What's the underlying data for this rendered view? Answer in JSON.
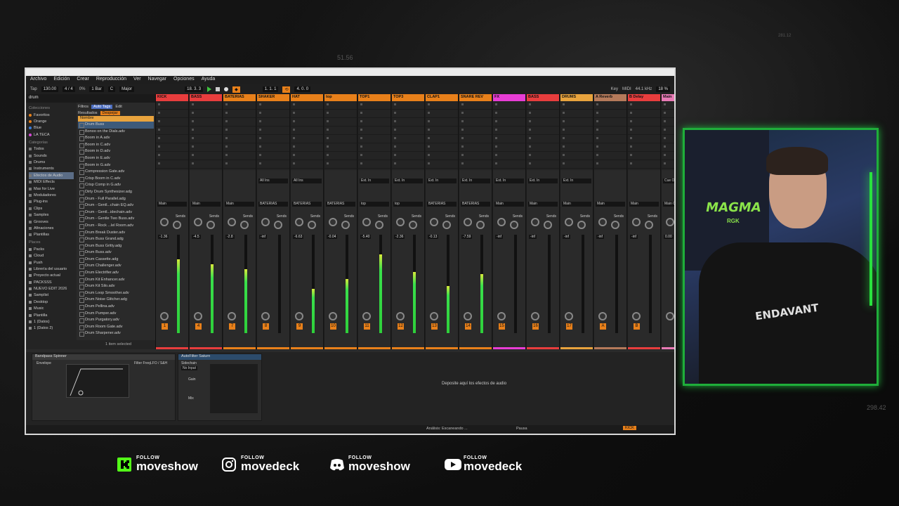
{
  "background": {
    "numbers": [
      "51.56",
      "281.12",
      "298.42"
    ]
  },
  "menu": [
    "Archivo",
    "Edición",
    "Crear",
    "Reproducción",
    "Ver",
    "Navegar",
    "Opciones",
    "Ayuda"
  ],
  "transport": {
    "tap": "Tap",
    "bpm": "130.00",
    "signature": "4 / 4",
    "pct": "0%",
    "bar": "1 Bar",
    "key": "C",
    "scale": "Major",
    "position": "18. 3. 3",
    "loop_start": "1. 1. 1",
    "loop_len": "4. 0. 0",
    "key_label": "Key",
    "midi_label": "MIDI",
    "sample_rate": "44.1 kHz",
    "cpu": "18 %"
  },
  "browser": {
    "search": "drum",
    "filters": "Filtros",
    "auto_tags": "Auto Tags",
    "edit": "Edit",
    "results_label": "Resultados",
    "clear_label": "Despejar",
    "name_header": "Nombre",
    "colecciones_head": "Colecciones",
    "colecciones": [
      {
        "label": "Favoritos",
        "color": "#e8801a"
      },
      {
        "label": "Orange",
        "color": "#e8801a"
      },
      {
        "label": "Blue",
        "color": "#3a7bd5"
      },
      {
        "label": "LA TECA",
        "color": "#d54ad5"
      }
    ],
    "categorias_head": "Categorías",
    "categorias": [
      "Todos",
      "Sounds",
      "Drums",
      "Instruments",
      "Efectos de Audio",
      "MIDI Effects",
      "Max for Live",
      "Moduladores",
      "Plug-ins",
      "Clips",
      "Samples",
      "Grooves",
      "Afinaciones",
      "Plantillas"
    ],
    "lugares_head": "Places",
    "lugares": [
      "Packs",
      "Cloud",
      "Push",
      "Librería del usuario",
      "Proyecto actual",
      "PACKSSS",
      "NUEVO EDIT 2026",
      "Samplist",
      "Desktop",
      "Music",
      "Plantilla",
      "1 (Datos)",
      "1 (Datos 2)"
    ],
    "items": [
      "Drum Buss",
      "Bonoo on the Dials.adv",
      "Boom in A.adv",
      "Boom in C.adv",
      "Boom in D.adv",
      "Boom in E.adv",
      "Boom in G.adv",
      "Compression Gate.adv",
      "Crisp Boom in C.adv",
      "Crisp Comp in G.adv",
      "Dirty Drum Synthesizer.adg",
      "Drum - Full Parallel.adg",
      "Drum - Gentl...chain EQ.adv",
      "Drum - Gentl...idechain.adv",
      "Drum - Gentle Two Buss.adv",
      "Drum - Rock ...lel Room.adv",
      "Drum Break Duster.adv",
      "Drum Buss Grand.adg",
      "Drum Buss Gritty.adg",
      "Drum Buss.adv",
      "Drum Cassette.adg",
      "Drum Challenger.adv",
      "Drum Electrifier.adv",
      "Drum Kit Enhancer.adv",
      "Drum Kit Silo.adv",
      "Drum Loop Smoother.adv",
      "Drum Noise Glitcher.adg",
      "Drum Pellina.adv",
      "Drum Pumper.adv",
      "Drum Purgatory.adv",
      "Drum Room Gate.adv",
      "Drum Sharpener.adv"
    ],
    "footer": "1 item selected"
  },
  "mixer": {
    "sends_label": "Sends",
    "tracks": [
      {
        "name": "KICK",
        "color": "#e83d3d",
        "vol": "-1.36",
        "num": "1",
        "meter": 0.75,
        "input": "",
        "route": "Main"
      },
      {
        "name": "BASS",
        "color": "#e83d3d",
        "vol": "-4.5",
        "num": "4",
        "meter": 0.7,
        "input": "",
        "route": "Main"
      },
      {
        "name": "BATERIAS",
        "color": "#e8801a",
        "vol": "-2.8",
        "num": "7",
        "meter": 0.65,
        "input": "",
        "route": "Main"
      },
      {
        "name": "SHAKER",
        "color": "#e8801a",
        "vol": "-inf",
        "num": "8",
        "meter": 0.0,
        "input": "All Ins",
        "route": "BATERIAS"
      },
      {
        "name": "HAT",
        "color": "#e8801a",
        "vol": "-6.63",
        "num": "9",
        "meter": 0.45,
        "input": "All Ins",
        "route": "BATERIAS"
      },
      {
        "name": "top",
        "color": "#e8801a",
        "vol": "-0.04",
        "num": "10",
        "meter": 0.55,
        "input": "",
        "route": "BATERIAS"
      },
      {
        "name": "TOP1",
        "color": "#e8801a",
        "vol": "-5.40",
        "num": "11",
        "meter": 0.8,
        "input": "Ext. In",
        "route": "top"
      },
      {
        "name": "TOP3",
        "color": "#e8801a",
        "vol": "-2.36",
        "num": "12",
        "meter": 0.62,
        "input": "Ext. In",
        "route": "top"
      },
      {
        "name": "CLAP1",
        "color": "#e8801a",
        "vol": "-0.13",
        "num": "13",
        "meter": 0.48,
        "input": "Ext. In",
        "route": "BATERIAS"
      },
      {
        "name": "SNARE REV",
        "color": "#e8801a",
        "vol": "-7.59",
        "num": "14",
        "meter": 0.6,
        "input": "Ext. In",
        "route": "BATERIAS"
      },
      {
        "name": "FX",
        "color": "#e83dd5",
        "vol": "-inf",
        "num": "15",
        "meter": 0.0,
        "input": "Ext. In",
        "route": "Main"
      },
      {
        "name": "BASS",
        "color": "#e83d3d",
        "vol": "-inf",
        "num": "16",
        "meter": 0.0,
        "input": "Ext. In",
        "route": "Main"
      },
      {
        "name": "DRUMS",
        "color": "#e8a33d",
        "vol": "-inf",
        "num": "17",
        "meter": 0.0,
        "input": "Ext. In",
        "route": "Main"
      },
      {
        "name": "A Reverb",
        "color": "#b57a5a",
        "vol": "-inf",
        "num": "A",
        "meter": 0.0,
        "input": "",
        "route": "Main"
      },
      {
        "name": "B Delay",
        "color": "#e83d3d",
        "vol": "-inf",
        "num": "B",
        "meter": 0.0,
        "input": "",
        "route": "Main"
      },
      {
        "name": "Main",
        "color": "#e87ab5",
        "vol": "0.00",
        "num": "",
        "meter": 0.55,
        "input": "Cue Out",
        "route": "Main Out"
      }
    ]
  },
  "devices": {
    "dev1_title": "Bandpass Spinner",
    "dev2_title": "AutoFilter Saturn",
    "envelope": "Envelope",
    "filter_freq": "Filter Freq",
    "lfo": "LFO / S&H",
    "sidechain": "Sidechain",
    "no_input": "No Input",
    "gain": "Gain",
    "mix": "Mix",
    "drop_text": "Deposite aquí los efectos de audio"
  },
  "status": {
    "analysis": "Análisis: Escaneando ...",
    "pause": "Pausa",
    "track": "KICK"
  },
  "webcam": {
    "sign": "MAGMA",
    "sign_small": "RGK",
    "shirt": "ENDAVANT"
  },
  "socials": [
    {
      "follow": "FOLLOW",
      "handle": "moveshow",
      "icon": "kick-icon",
      "color": "#53fc18"
    },
    {
      "follow": "FOLLOW",
      "handle": "movedeck",
      "icon": "instagram-icon",
      "color": "#ffffff"
    },
    {
      "follow": "FOLLOW",
      "handle": "moveshow",
      "icon": "discord-icon",
      "color": "#ffffff"
    },
    {
      "follow": "FOLLOW",
      "handle": "movedeck",
      "icon": "youtube-icon",
      "color": "#ffffff"
    }
  ]
}
